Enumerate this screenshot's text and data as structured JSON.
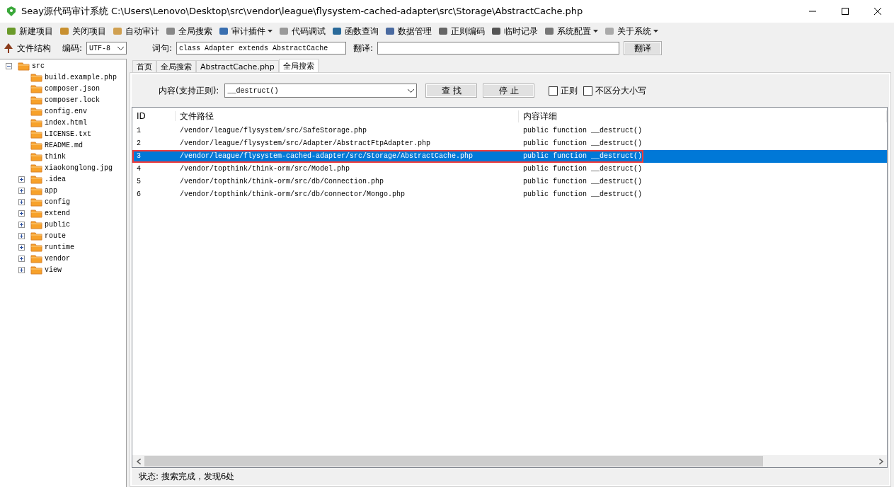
{
  "window": {
    "title": "Seay源代码审计系统  C:\\Users\\Lenovo\\Desktop\\src\\vendor\\league\\flysystem-cached-adapter\\src\\Storage\\AbstractCache.php"
  },
  "toolbar": [
    {
      "label": "新建项目",
      "dropdown": false
    },
    {
      "label": "关闭项目",
      "dropdown": false
    },
    {
      "label": "自动审计",
      "dropdown": false
    },
    {
      "label": "全局搜索",
      "dropdown": false
    },
    {
      "label": "审计插件",
      "dropdown": true
    },
    {
      "label": "代码调试",
      "dropdown": false
    },
    {
      "label": "函数查询",
      "dropdown": false
    },
    {
      "label": "数据管理",
      "dropdown": false
    },
    {
      "label": "正则编码",
      "dropdown": false
    },
    {
      "label": "临时记录",
      "dropdown": false
    },
    {
      "label": "系统配置",
      "dropdown": true
    },
    {
      "label": "关于系统",
      "dropdown": true
    }
  ],
  "secondbar": {
    "tree_title": "文件结构",
    "encoding_label": "编码:",
    "encoding": "UTF-8",
    "query_label": "词句:",
    "query": "class Adapter extends AbstractCache",
    "translate_label": "翻译:",
    "translate_button": "翻译"
  },
  "tree": [
    {
      "label": "src",
      "kind": "folder",
      "expanded": true,
      "children": [
        {
          "label": "build.example.php",
          "kind": "file"
        },
        {
          "label": "composer.json",
          "kind": "file"
        },
        {
          "label": "composer.lock",
          "kind": "file"
        },
        {
          "label": "config.env",
          "kind": "file"
        },
        {
          "label": "index.html",
          "kind": "file"
        },
        {
          "label": "LICENSE.txt",
          "kind": "file"
        },
        {
          "label": "README.md",
          "kind": "file"
        },
        {
          "label": "think",
          "kind": "file"
        },
        {
          "label": "xiaokonglong.jpg",
          "kind": "file"
        },
        {
          "label": ".idea",
          "kind": "folder",
          "expanded": false
        },
        {
          "label": "app",
          "kind": "folder",
          "expanded": false
        },
        {
          "label": "config",
          "kind": "folder",
          "expanded": false
        },
        {
          "label": "extend",
          "kind": "folder",
          "expanded": false
        },
        {
          "label": "public",
          "kind": "folder",
          "expanded": false
        },
        {
          "label": "route",
          "kind": "folder",
          "expanded": false
        },
        {
          "label": "runtime",
          "kind": "folder",
          "expanded": false
        },
        {
          "label": "vendor",
          "kind": "folder",
          "expanded": false
        },
        {
          "label": "view",
          "kind": "folder",
          "expanded": false
        }
      ]
    }
  ],
  "tabs": [
    {
      "label": "首页",
      "selected": false
    },
    {
      "label": "全局搜索",
      "selected": false
    },
    {
      "label": "AbstractCache.php",
      "selected": false
    },
    {
      "label": "全局搜索",
      "selected": true
    }
  ],
  "search": {
    "label": "内容(支持正则):",
    "value": "__destruct()",
    "find_button": "查 找",
    "stop_button": "停 止",
    "options": [
      {
        "label": "正则",
        "checked": false
      },
      {
        "label": "不区分大小写",
        "checked": false
      }
    ]
  },
  "table": {
    "columns": [
      "ID",
      "文件路径",
      "内容详细"
    ],
    "rows": [
      {
        "id": "1",
        "path": "/vendor/league/flysystem/src/SafeStorage.php",
        "detail": "public function __destruct()",
        "selected": false
      },
      {
        "id": "2",
        "path": "/vendor/league/flysystem/src/Adapter/AbstractFtpAdapter.php",
        "detail": "public function __destruct()",
        "selected": false
      },
      {
        "id": "3",
        "path": "/vendor/league/flysystem-cached-adapter/src/Storage/AbstractCache.php",
        "detail": "public function __destruct()",
        "selected": true
      },
      {
        "id": "4",
        "path": "/vendor/topthink/think-orm/src/Model.php",
        "detail": "public function __destruct()",
        "selected": false
      },
      {
        "id": "5",
        "path": "/vendor/topthink/think-orm/src/db/Connection.php",
        "detail": "public function __destruct()",
        "selected": false
      },
      {
        "id": "6",
        "path": "/vendor/topthink/think-orm/src/db/connector/Mongo.php",
        "detail": "public function __destruct()",
        "selected": false
      }
    ]
  },
  "status_bar": "状态: 搜索完成，发现6处"
}
